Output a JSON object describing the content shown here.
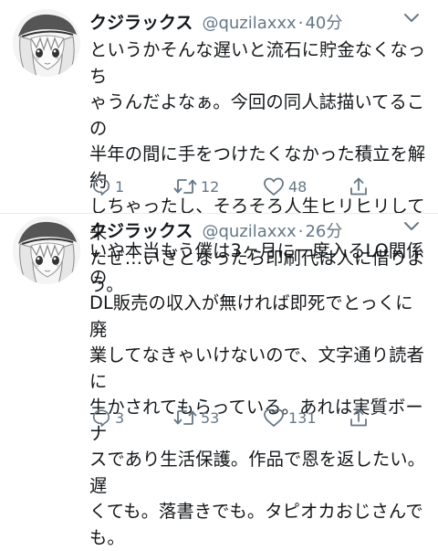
{
  "tweets": [
    {
      "display_name": "クジラックス",
      "handle": "@quzilaxxx",
      "separator": "·",
      "time": "40分",
      "text": "というかそんな遅いと流石に貯金なくなっち\nゃうんだよなぁ。今回の同人誌描いてるこの\n半年の間に手をつけたくなかった積立を解約\nしちゃったし、そろそろ人生ヒリヒリして来\nたぜ…いざとなったら印刷代は人に借りよ\nう。",
      "replies": "1",
      "retweets": "12",
      "likes": "48"
    },
    {
      "display_name": "クジラックス",
      "handle": "@quzilaxxx",
      "separator": "·",
      "time": "26分",
      "text": "いや本当もう僕は3ヶ月に一度入るLO関係の\nDL販売の収入が無ければ即死でとっくに廃\n業してなきゃいけないので、文字通り読者に\n生かされてもらっている。あれは実質ボーナ\nスであり生活保護。作品で恩を返したい。遅\nくても。落書きでも。タピオカおじさんで\nも。",
      "replies": "3",
      "retweets": "53",
      "likes": "131"
    }
  ],
  "icons": {
    "avatar": "avatar-icon",
    "more": "chevron-down-icon",
    "reply": "reply-icon",
    "retweet": "retweet-icon",
    "like": "heart-icon",
    "share": "share-icon"
  },
  "colors": {
    "text": "#14171a",
    "secondary": "#657786",
    "divider": "#e6ecf0"
  }
}
